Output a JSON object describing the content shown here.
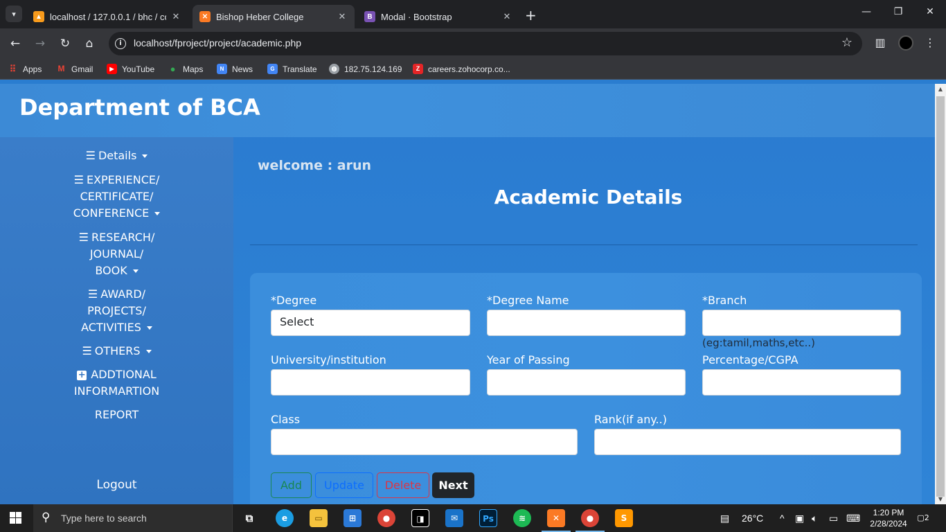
{
  "browser": {
    "tabs": [
      {
        "title": "localhost / 127.0.0.1 / bhc / con",
        "favicon_color": "#f89b1c",
        "favicon_glyph": "▲"
      },
      {
        "title": "Bishop Heber College",
        "favicon_color": "#fb7a24",
        "favicon_glyph": "✕"
      },
      {
        "title": "Modal · Bootstrap",
        "favicon_color": "#7952b3",
        "favicon_glyph": "B"
      }
    ],
    "url": "localhost/fproject/project/academic.php",
    "bookmarks": [
      {
        "label": "Apps",
        "icon": "apps-grid-icon",
        "color": "#ea4335"
      },
      {
        "label": "Gmail",
        "icon": "gmail-icon",
        "color": "#ea4335"
      },
      {
        "label": "YouTube",
        "icon": "youtube-icon",
        "color": "#ff0000"
      },
      {
        "label": "Maps",
        "icon": "maps-icon",
        "color": "#34a853"
      },
      {
        "label": "News",
        "icon": "news-icon",
        "color": "#4285f4"
      },
      {
        "label": "Translate",
        "icon": "translate-icon",
        "color": "#4285f4"
      },
      {
        "label": "182.75.124.169",
        "icon": "globe-icon",
        "color": "#9aa0a6"
      },
      {
        "label": "careers.zohocorp.co...",
        "icon": "zoho-icon",
        "color": "#e42527"
      }
    ]
  },
  "page": {
    "site_title": "Department of BCA",
    "welcome": "welcome : arun",
    "heading": "Academic Details",
    "sidebar": {
      "items": [
        {
          "lines": [
            "Details"
          ],
          "hamburger": true,
          "caret": true
        },
        {
          "lines": [
            "EXPERIENCE/",
            "CERTIFICATE/",
            "CONFERENCE"
          ],
          "hamburger": true,
          "caret": true
        },
        {
          "lines": [
            "RESEARCH/",
            "JOURNAL/",
            "BOOK"
          ],
          "hamburger": true,
          "caret": true
        },
        {
          "lines": [
            "AWARD/",
            "PROJECTS/",
            "ACTIVITIES"
          ],
          "hamburger": true,
          "caret": true
        },
        {
          "lines": [
            "OTHERS"
          ],
          "hamburger": true,
          "caret": true
        },
        {
          "lines": [
            "ADDTIONAL",
            "INFORMARTION"
          ],
          "plus": true
        },
        {
          "lines": [
            "REPORT"
          ]
        }
      ],
      "logout": "Logout"
    },
    "form": {
      "degree_label": "*Degree",
      "degree_value": "Select",
      "degree_name_label": "*Degree Name",
      "branch_label": "*Branch",
      "branch_hint": "(eg:tamil,maths,etc..)",
      "university_label": "University/institution",
      "year_label": "Year of Passing",
      "percentage_label": "Percentage/CGPA",
      "class_label": "Class",
      "rank_label": "Rank(if any..)",
      "buttons": {
        "add": "Add",
        "update": "Update",
        "delete": "Delete",
        "next": "Next"
      }
    }
  },
  "taskbar": {
    "search_placeholder": "Type here to search",
    "weather": "26°C",
    "time": "1:20 PM",
    "date": "2/28/2024",
    "notification_count": "2"
  }
}
